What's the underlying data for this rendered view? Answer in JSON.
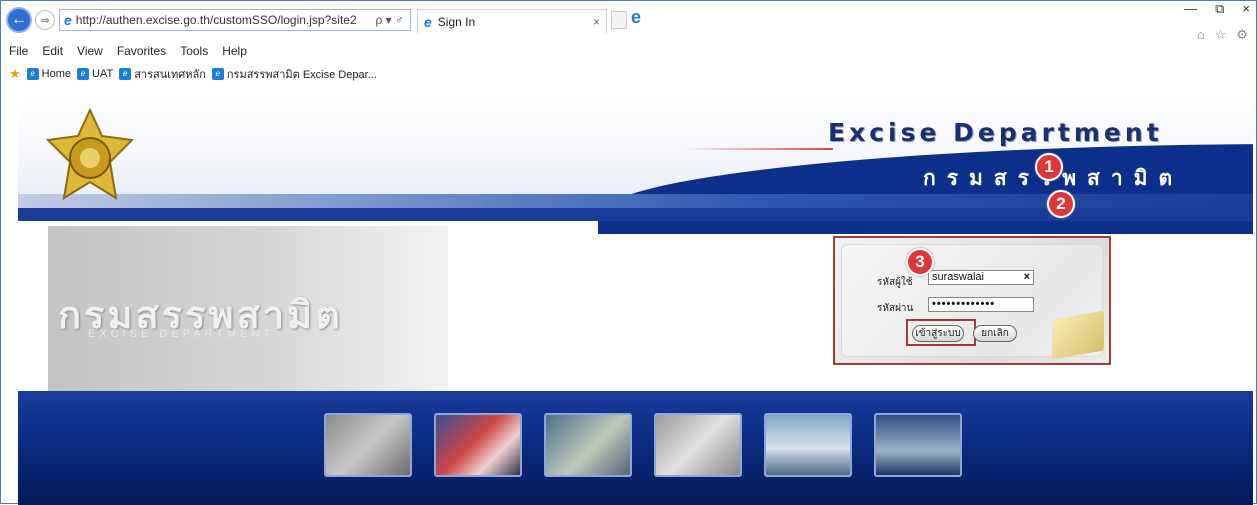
{
  "browser": {
    "address_url": "http://authen.excise.go.th/customSSO/login.jsp?site2",
    "address_controls": "ρ ▾ ♂",
    "tab_title": "Sign In",
    "tab_close": "×",
    "window_controls": [
      "—",
      "⧉",
      "×"
    ],
    "right_icons": [
      "⌂",
      "☆",
      "⚙"
    ],
    "menu": [
      "File",
      "Edit",
      "View",
      "Favorites",
      "Tools",
      "Help"
    ],
    "favorites": [
      "Home",
      "UAT",
      "สารสนเทศหลัก",
      "กรมสรรพสามิต Excise Depar..."
    ]
  },
  "site": {
    "title_en": "Excise Department",
    "title_th": "กรมสรรพสามิต",
    "photo_text": "กรมสรรพสามิต",
    "photo_subtext": "EXCISE DEPARTMENT"
  },
  "login": {
    "username_label": "รหัสผู้ใช้",
    "username_value": "suraswalai",
    "clear": "×",
    "password_label": "รหัสผ่าน",
    "password_value": "•••••••••••••",
    "login_button": "เข้าสู่ระบบ",
    "cancel_button": "ยกเลิก"
  },
  "annotations": [
    "1",
    "2",
    "3"
  ],
  "colors": {
    "banner_blue": "#0b2f8a",
    "annotation_red": "#e0363a",
    "highlight_border": "#a33b3b"
  }
}
